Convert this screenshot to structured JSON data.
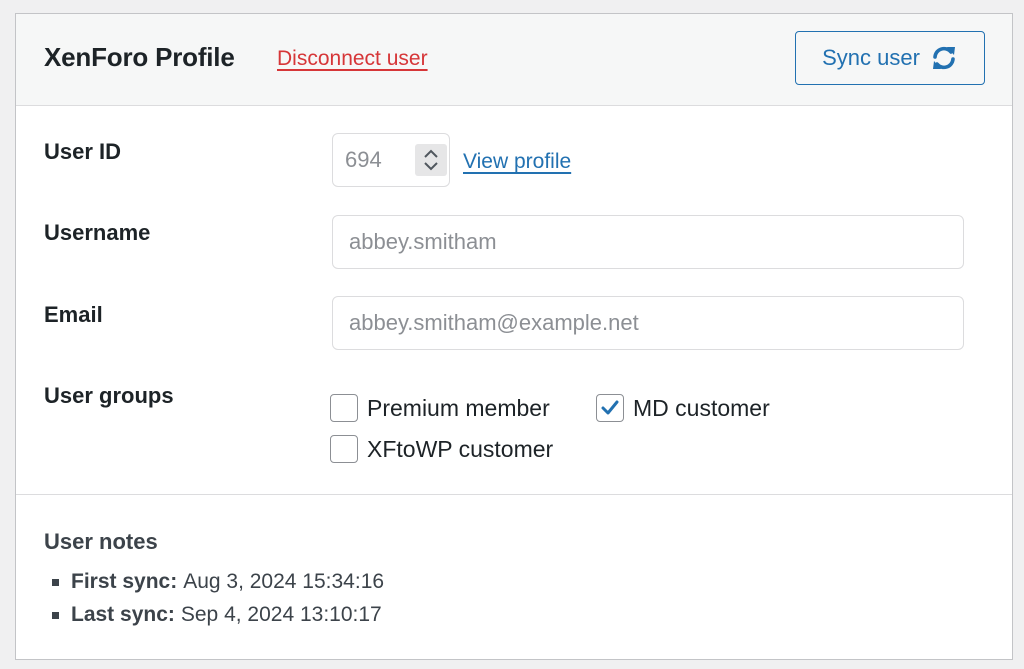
{
  "header": {
    "title": "XenForo Profile",
    "disconnect_label": "Disconnect user",
    "sync_label": "Sync user",
    "sync_icon": "refresh-icon"
  },
  "fields": {
    "user_id": {
      "label": "User ID",
      "value": "694",
      "link_label": "View profile"
    },
    "username": {
      "label": "Username",
      "value": "abbey.smitham"
    },
    "email": {
      "label": "Email",
      "value": "abbey.smitham@example.net"
    }
  },
  "user_groups": {
    "label": "User groups",
    "options": [
      {
        "label": "Premium member",
        "checked": false
      },
      {
        "label": "MD customer",
        "checked": true
      },
      {
        "label": "XFtoWP customer",
        "checked": false
      }
    ]
  },
  "notes": {
    "title": "User notes",
    "items": [
      {
        "key": "First sync:",
        "value": "Aug 3, 2024 15:34:16"
      },
      {
        "key": "Last sync:",
        "value": "Sep 4, 2024 13:10:17"
      }
    ]
  },
  "colors": {
    "accent": "#2271b1",
    "danger": "#d63638"
  }
}
